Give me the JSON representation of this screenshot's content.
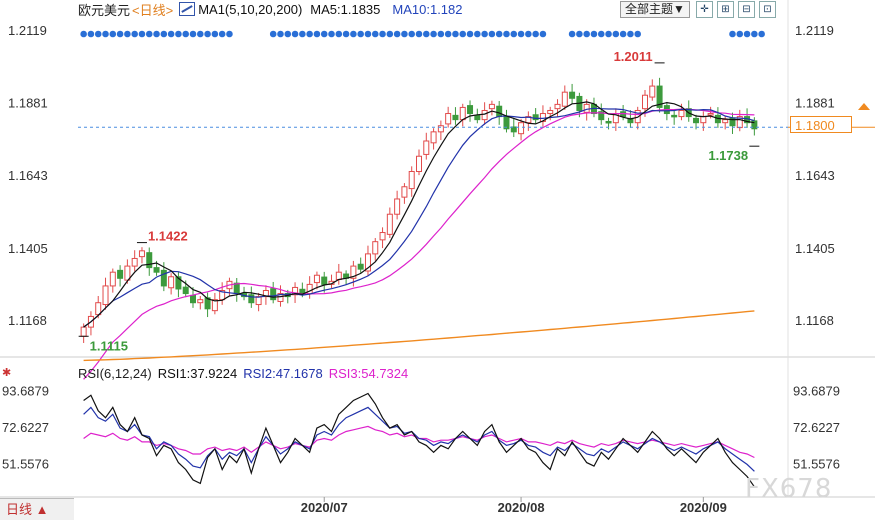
{
  "header": {
    "symbol": "欧元美元",
    "period": "<日线>",
    "ma_label": "MA1(5,10,20,200)",
    "ma5_label": "MA5:1.1835",
    "ma10_label": "MA10:1.182",
    "theme_button": "全部主题▼",
    "icon_names": [
      "crosshair-icon",
      "zoom-in-icon",
      "zoom-out-icon",
      "reset-icon"
    ]
  },
  "rsi_header": {
    "label": "RSI(6,12,24)",
    "rsi1": "RSI1:37.9224",
    "rsi2": "RSI2:47.1678",
    "rsi3": "RSI3:54.7324"
  },
  "bottom_tab": "日线 ▲",
  "watermark": "FX678",
  "current_price": "1.1800",
  "colors": {
    "up": "#e24b4b",
    "down": "#3d9a3d",
    "ma5": "#111111",
    "ma10": "#2233aa",
    "ma20": "#dd22cc",
    "ma200": "#f08a20",
    "dashed": "#4a8ee0",
    "rsi1": "#111111",
    "rsi2": "#2233aa",
    "rsi3": "#dd22cc",
    "event_dots": "#2a6fd6"
  },
  "chart_data": [
    {
      "type": "candlestick",
      "y_ticks": [
        "1.2119",
        "1.1881",
        "1.1643",
        "1.1405",
        "1.1168"
      ],
      "y_tick_values": [
        1.2119,
        1.1881,
        1.1643,
        1.1405,
        1.1168
      ],
      "ylim": [
        1.107,
        1.2145
      ],
      "x_labels": [
        "2020/07",
        "2020/08",
        "2020/09"
      ],
      "x_label_index": [
        33,
        60,
        85
      ],
      "annotations": [
        {
          "text": "1.2011",
          "index": 79,
          "value": 1.2011,
          "kind": "high"
        },
        {
          "text": "1.1738",
          "index": 92,
          "value": 1.1738,
          "kind": "low"
        },
        {
          "text": "1.1422",
          "index": 8,
          "value": 1.1422,
          "kind": "high"
        },
        {
          "text": "1.1115",
          "index": 0,
          "value": 1.1115,
          "kind": "low"
        }
      ],
      "dashed_price": 1.18,
      "event_dot_ranges": [
        [
          0,
          20
        ],
        [
          26,
          63
        ],
        [
          67,
          76
        ],
        [
          89,
          93
        ]
      ],
      "closes": [
        1.1145,
        1.118,
        1.1225,
        1.128,
        1.1325,
        1.1305,
        1.1345,
        1.137,
        1.1395,
        1.134,
        1.1325,
        1.128,
        1.131,
        1.127,
        1.1255,
        1.1225,
        1.1235,
        1.1205,
        1.1235,
        1.1265,
        1.1295,
        1.1255,
        1.1245,
        1.1225,
        1.1245,
        1.1265,
        1.1235,
        1.1255,
        1.1245,
        1.1275,
        1.1255,
        1.1285,
        1.1315,
        1.1285,
        1.1295,
        1.1325,
        1.1305,
        1.1345,
        1.1335,
        1.1385,
        1.1425,
        1.1455,
        1.1515,
        1.1565,
        1.1605,
        1.1655,
        1.1705,
        1.1755,
        1.1785,
        1.1805,
        1.1845,
        1.1825,
        1.1865,
        1.1845,
        1.1825,
        1.1855,
        1.1875,
        1.1835,
        1.1795,
        1.1785,
        1.1815,
        1.1835,
        1.1825,
        1.1845,
        1.1855,
        1.1875,
        1.1915,
        1.1895,
        1.1855,
        1.1875,
        1.1845,
        1.1825,
        1.1815,
        1.1845,
        1.1835,
        1.1815,
        1.1855,
        1.1905,
        1.1935,
        1.1865,
        1.1845,
        1.1835,
        1.1855,
        1.1835,
        1.1815,
        1.1835,
        1.1845,
        1.1815,
        1.1825,
        1.1805,
        1.1835,
        1.1815,
        1.1795
      ],
      "ma200_start": 1.1036,
      "ma200_end": 1.1198
    },
    {
      "type": "line",
      "title": "RSI(6,12,24)",
      "y_ticks": [
        "93.6879",
        "72.6227",
        "51.5576"
      ],
      "y_tick_values": [
        93.6879,
        72.6227,
        51.5576
      ],
      "ylim": [
        35,
        101
      ],
      "series": [
        {
          "name": "RSI1",
          "values": [
            88,
            91,
            82,
            78,
            84,
            74,
            70,
            78,
            68,
            66,
            56,
            62,
            60,
            52,
            48,
            42,
            40,
            55,
            60,
            48,
            56,
            52,
            60,
            46,
            60,
            72,
            62,
            52,
            58,
            66,
            62,
            58,
            72,
            74,
            70,
            80,
            84,
            88,
            90,
            92,
            86,
            78,
            72,
            74,
            68,
            70,
            64,
            62,
            58,
            62,
            60,
            66,
            70,
            66,
            62,
            70,
            74,
            64,
            58,
            62,
            66,
            60,
            58,
            52,
            48,
            60,
            56,
            64,
            58,
            52,
            50,
            58,
            54,
            60,
            66,
            62,
            58,
            64,
            70,
            66,
            60,
            56,
            60,
            56,
            52,
            58,
            62,
            66,
            58,
            52,
            48,
            44,
            38
          ]
        },
        {
          "name": "RSI2",
          "values": [
            80,
            84,
            78,
            76,
            80,
            72,
            70,
            74,
            68,
            67,
            60,
            64,
            62,
            57,
            54,
            50,
            49,
            56,
            60,
            54,
            58,
            56,
            60,
            52,
            60,
            67,
            62,
            57,
            60,
            64,
            62,
            60,
            68,
            70,
            68,
            74,
            78,
            80,
            82,
            84,
            80,
            76,
            72,
            73,
            69,
            70,
            66,
            65,
            62,
            64,
            63,
            66,
            68,
            66,
            64,
            68,
            70,
            65,
            62,
            63,
            65,
            62,
            61,
            58,
            56,
            61,
            59,
            63,
            60,
            57,
            56,
            60,
            58,
            61,
            64,
            62,
            60,
            63,
            66,
            64,
            61,
            59,
            61,
            59,
            57,
            60,
            62,
            64,
            60,
            57,
            54,
            51,
            47
          ]
        },
        {
          "name": "RSI3",
          "values": [
            66,
            69,
            68,
            67,
            69,
            66,
            65,
            67,
            64,
            64,
            62,
            63,
            62,
            60,
            59,
            57,
            57,
            60,
            61,
            59,
            60,
            59,
            61,
            58,
            61,
            64,
            62,
            60,
            61,
            63,
            62,
            61,
            65,
            66,
            65,
            68,
            70,
            71,
            72,
            73,
            71,
            70,
            68,
            69,
            67,
            68,
            66,
            66,
            64,
            65,
            65,
            66,
            67,
            66,
            65,
            67,
            68,
            66,
            64,
            65,
            66,
            64,
            64,
            63,
            62,
            64,
            63,
            65,
            63,
            62,
            61,
            63,
            62,
            63,
            65,
            64,
            63,
            64,
            65,
            64,
            63,
            62,
            63,
            62,
            61,
            62,
            63,
            64,
            62,
            60,
            58,
            57,
            55
          ]
        }
      ]
    }
  ]
}
